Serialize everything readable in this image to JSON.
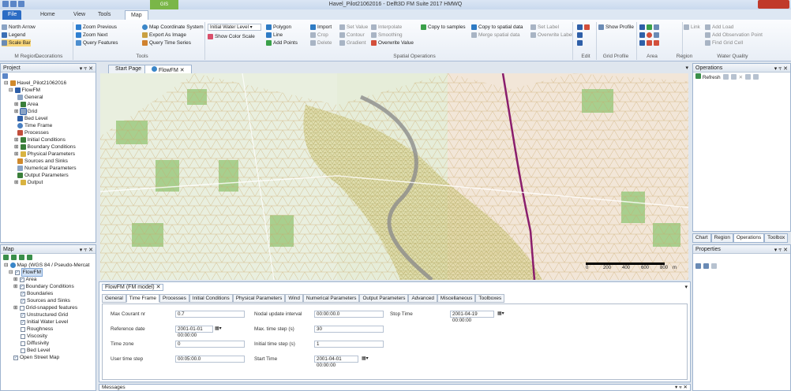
{
  "window": {
    "title": "Havel_Pilot21062016 - Delft3D FM Suite 2017 HMWQ",
    "context_tab": "GIS"
  },
  "tabs": [
    "File",
    "Home",
    "View",
    "Tools",
    "Map"
  ],
  "ribbon": {
    "decorations": {
      "items": [
        "North Arrow",
        "Legend",
        "Scale Bar"
      ],
      "label": "Decorations"
    },
    "tools": {
      "items": [
        "Zoom Previous",
        "Zoom Next",
        "Query Features",
        "Map Coordinate System",
        "Export As Image",
        "Query Time Series"
      ],
      "label": "Tools"
    },
    "layer_combo": {
      "value": "Initial Water Level",
      "item": "Show Color Scale"
    },
    "spatial": {
      "items": [
        "Polygon",
        "Line",
        "Add Points",
        "Import",
        "Crop",
        "Delete",
        "Set Value",
        "Contour",
        "Gradient",
        "Interpolate",
        "Smoothing",
        "Overwrite Value",
        "Copy to samples",
        "Copy to spatial data",
        "Merge spatial data",
        "Set Label",
        "Overwrite Label"
      ],
      "label": "Spatial Operations"
    },
    "region_label": "M Region...",
    "edit_label": "Edit",
    "grid_profile": {
      "item": "Show Profile",
      "label": "Grid Profile"
    },
    "area_label": "Area",
    "region_group_label": "Region",
    "water_quality": {
      "items": [
        "Link",
        "Add Load",
        "Add Observation Point",
        "Find Grid Cell"
      ],
      "label": "Water Quality"
    }
  },
  "project": {
    "title": "Project",
    "items": [
      "Havel_Pilot21062016",
      "FlowFM",
      "General",
      "Area",
      "Grid",
      "Bed Level",
      "Time Frame",
      "Processes",
      "Initial Conditions",
      "Boundary Conditions",
      "Physical Parameters",
      "Sources and Sinks",
      "Numerical Parameters",
      "Output Parameters",
      "Output"
    ]
  },
  "map_panel": {
    "title": "Map",
    "items": [
      "Map (WGS 84 / Pseudo-Mercat",
      "FlowFM",
      "Area",
      "Boundary Conditions",
      "Boundaries",
      "Sources and Sinks",
      "Grid-snapped features",
      "Unstructured Grid",
      "Initial Water Level",
      "Roughness",
      "Viscosity",
      "Diffusivity",
      "Bed Level",
      "Open Street Map"
    ]
  },
  "doc_tabs": [
    "Start Page",
    "FlowFM"
  ],
  "scale_ticks": [
    "0",
    "200",
    "400",
    "600",
    "800"
  ],
  "scale_unit": "m",
  "model": {
    "title": "FlowFM (FM model)",
    "tabs": [
      "General",
      "Time Frame",
      "Processes",
      "Initial Conditions",
      "Physical Parameters",
      "Wind",
      "Numerical Parameters",
      "Output Parameters",
      "Advanced",
      "Miscellaneous",
      "Toolboxes"
    ],
    "fields": {
      "courant_label": "Max Courant nr",
      "courant": "0.7",
      "refdate_label": "Reference date",
      "refdate": "2001-01-01 00:00:00",
      "timezone_label": "Time zone",
      "timezone": "0",
      "usertimestep_label": "User time step",
      "usertimestep": "00:05:00.0",
      "nodal_label": "Nodal update interval",
      "nodal": "00:00:00.0",
      "maxstep_label": "Max. time step (s)",
      "maxstep": "30",
      "initstep_label": "Initial time step (s)",
      "initstep": "1",
      "start_label": "Start Time",
      "start": "2001-04-01 00:00:00",
      "stop_label": "Stop Time",
      "stop": "2001-04-19 00:00:00"
    }
  },
  "messages_title": "Messages",
  "operations": {
    "title": "Operations",
    "refresh": "Refresh"
  },
  "side_tabs": [
    "Chart",
    "Region",
    "Operations",
    "Toolbox"
  ],
  "properties_title": "Properties"
}
